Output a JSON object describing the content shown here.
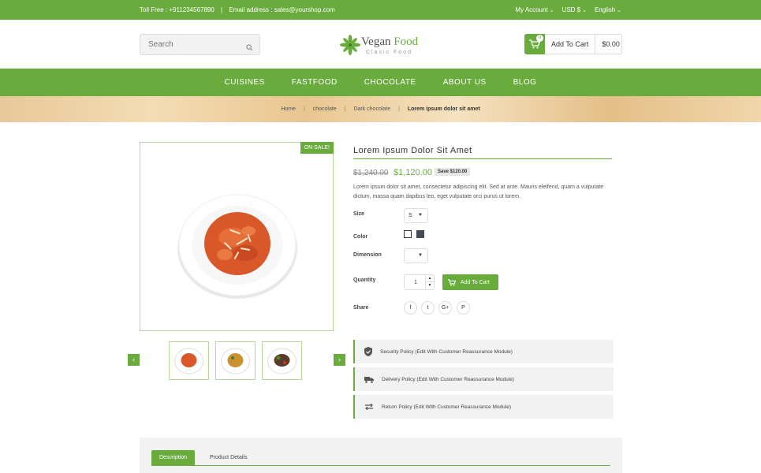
{
  "topbar": {
    "toll_free": "Toll Free : +911234567890",
    "separator": "|",
    "email": "Email address : sales@yourshop.com",
    "account": "My Account",
    "currency": "USD $",
    "language": "English"
  },
  "search": {
    "placeholder": "Search"
  },
  "logo": {
    "name_part1": "Vegan ",
    "name_part2": "Food",
    "tagline": "Clasic Food"
  },
  "cart": {
    "count": "0",
    "label": "Add To Cart",
    "total": "$0.00"
  },
  "nav": {
    "items": [
      "CUISINES",
      "FASTFOOD",
      "CHOCOLATE",
      "ABOUT US",
      "BLOG"
    ]
  },
  "breadcrumb": {
    "items": [
      "Home",
      "chocolate",
      "Dark chocolate",
      "Lorem ipsum dolor sit amet"
    ],
    "separator": "|"
  },
  "product": {
    "sale_badge": "ON SALE!",
    "title": "Lorem Ipsum Dolor Sit Amet",
    "old_price": "$1,240.00",
    "new_price": "$1,120.00",
    "save": "Save $120.00",
    "description": "Lorem ipsum dolor sit amet, consectetur adipiscing elit. Sed at ante. Mauris eleifend, quam a vulputate dictum, massa quam dapibus leo, eget vulputate orci purus ut lorem.",
    "size_label": "Size",
    "size_value": "S",
    "color_label": "Color",
    "colors": [
      "#ffffff",
      "#434a54"
    ],
    "dimension_label": "Dimension",
    "dimension_value": "",
    "quantity_label": "Quantity",
    "quantity_value": "1",
    "add_to_cart": "Add To Cart",
    "share_label": "Share",
    "share_icons": [
      "f",
      "t",
      "G+",
      "P"
    ]
  },
  "policies": [
    "Security Policy (Edit With Customer Reassurance Module)",
    "Delivery Policy (Edit With Customer Reassurance Module)",
    "Return Policy (Edit With Customer Reassurance Module)"
  ],
  "tabs": {
    "active": "Description",
    "inactive": "Product Details"
  },
  "colors": {
    "accent": "#6aab3e"
  }
}
